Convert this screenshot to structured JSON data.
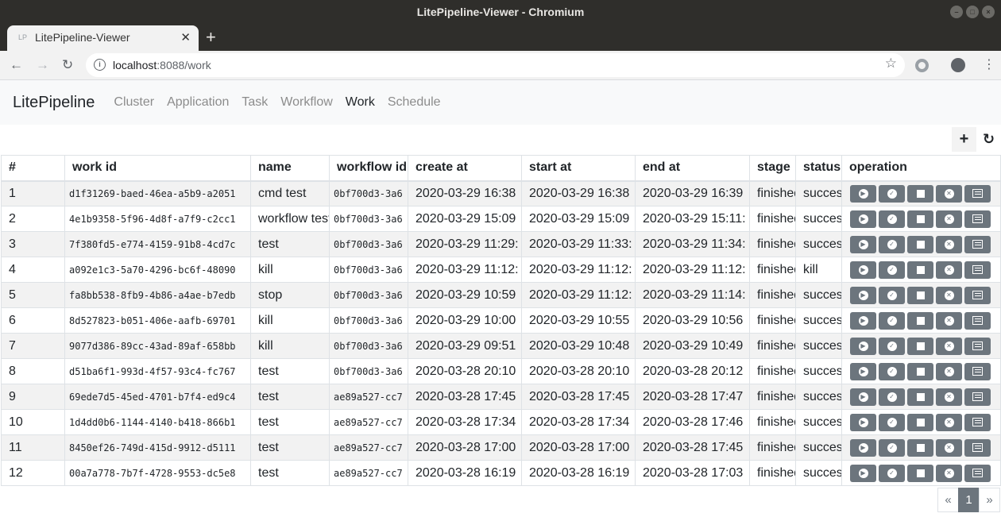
{
  "window": {
    "title": "LitePipeline-Viewer - Chromium"
  },
  "browser": {
    "tab_title": "LitePipeline-Viewer",
    "favicon": "LP",
    "url_host": "localhost",
    "url_rest": ":8088/work"
  },
  "nav": {
    "brand": "LitePipeline",
    "links": [
      "Cluster",
      "Application",
      "Task",
      "Workflow",
      "Work",
      "Schedule"
    ],
    "active": "Work"
  },
  "table": {
    "headers": [
      "#",
      "work id",
      "name",
      "workflow id",
      "create at",
      "start at",
      "end at",
      "stage",
      "status",
      "operation"
    ],
    "rows": [
      {
        "n": "1",
        "work_id": "d1f31269-baed-46ea-a5b9-a2051",
        "name": "cmd test",
        "workflow_id": "0bf700d3-3a6",
        "create": "2020-03-29 16:38",
        "start": "2020-03-29 16:38",
        "end": "2020-03-29 16:39",
        "stage": "finished",
        "status": "success"
      },
      {
        "n": "2",
        "work_id": "4e1b9358-5f96-4d8f-a7f9-c2cc1",
        "name": "workflow test",
        "workflow_id": "0bf700d3-3a6",
        "create": "2020-03-29 15:09",
        "start": "2020-03-29 15:09",
        "end": "2020-03-29 15:11:",
        "stage": "finished",
        "status": "success"
      },
      {
        "n": "3",
        "work_id": "7f380fd5-e774-4159-91b8-4cd7c",
        "name": "test",
        "workflow_id": "0bf700d3-3a6",
        "create": "2020-03-29 11:29:",
        "start": "2020-03-29 11:33:",
        "end": "2020-03-29 11:34:",
        "stage": "finished",
        "status": "success"
      },
      {
        "n": "4",
        "work_id": "a092e1c3-5a70-4296-bc6f-48090",
        "name": "kill",
        "workflow_id": "0bf700d3-3a6",
        "create": "2020-03-29 11:12:",
        "start": "2020-03-29 11:12:",
        "end": "2020-03-29 11:12:",
        "stage": "finished",
        "status": "kill"
      },
      {
        "n": "5",
        "work_id": "fa8bb538-8fb9-4b86-a4ae-b7edb",
        "name": "stop",
        "workflow_id": "0bf700d3-3a6",
        "create": "2020-03-29 10:59",
        "start": "2020-03-29 11:12:",
        "end": "2020-03-29 11:14:",
        "stage": "finished",
        "status": "success"
      },
      {
        "n": "6",
        "work_id": "8d527823-b051-406e-aafb-69701",
        "name": "kill",
        "workflow_id": "0bf700d3-3a6",
        "create": "2020-03-29 10:00",
        "start": "2020-03-29 10:55",
        "end": "2020-03-29 10:56",
        "stage": "finished",
        "status": "success"
      },
      {
        "n": "7",
        "work_id": "9077d386-89cc-43ad-89af-658bb",
        "name": "kill",
        "workflow_id": "0bf700d3-3a6",
        "create": "2020-03-29 09:51",
        "start": "2020-03-29 10:48",
        "end": "2020-03-29 10:49",
        "stage": "finished",
        "status": "success"
      },
      {
        "n": "8",
        "work_id": "d51ba6f1-993d-4f57-93c4-fc767",
        "name": "test",
        "workflow_id": "0bf700d3-3a6",
        "create": "2020-03-28 20:10",
        "start": "2020-03-28 20:10",
        "end": "2020-03-28 20:12",
        "stage": "finished",
        "status": "success"
      },
      {
        "n": "9",
        "work_id": "69ede7d5-45ed-4701-b7f4-ed9c4",
        "name": "test",
        "workflow_id": "ae89a527-cc7",
        "create": "2020-03-28 17:45",
        "start": "2020-03-28 17:45",
        "end": "2020-03-28 17:47",
        "stage": "finished",
        "status": "success"
      },
      {
        "n": "10",
        "work_id": "1d4dd0b6-1144-4140-b418-866b1",
        "name": "test",
        "workflow_id": "ae89a527-cc7",
        "create": "2020-03-28 17:34",
        "start": "2020-03-28 17:34",
        "end": "2020-03-28 17:46",
        "stage": "finished",
        "status": "success"
      },
      {
        "n": "11",
        "work_id": "8450ef26-749d-415d-9912-d5111",
        "name": "test",
        "workflow_id": "ae89a527-cc7",
        "create": "2020-03-28 17:00",
        "start": "2020-03-28 17:00",
        "end": "2020-03-28 17:45",
        "stage": "finished",
        "status": "success"
      },
      {
        "n": "12",
        "work_id": "00a7a778-7b7f-4728-9553-dc5e8",
        "name": "test",
        "workflow_id": "ae89a527-cc7",
        "create": "2020-03-28 16:19",
        "start": "2020-03-28 16:19",
        "end": "2020-03-28 17:03",
        "stage": "finished",
        "status": "success"
      }
    ],
    "operations": [
      "run-icon",
      "check-icon",
      "stop-icon",
      "delete-icon",
      "list-icon"
    ]
  },
  "toolbar": {
    "add_icon": "plus-icon",
    "refresh_icon": "refresh-icon"
  },
  "pagination": {
    "prev": "«",
    "current": "1",
    "next": "»"
  }
}
